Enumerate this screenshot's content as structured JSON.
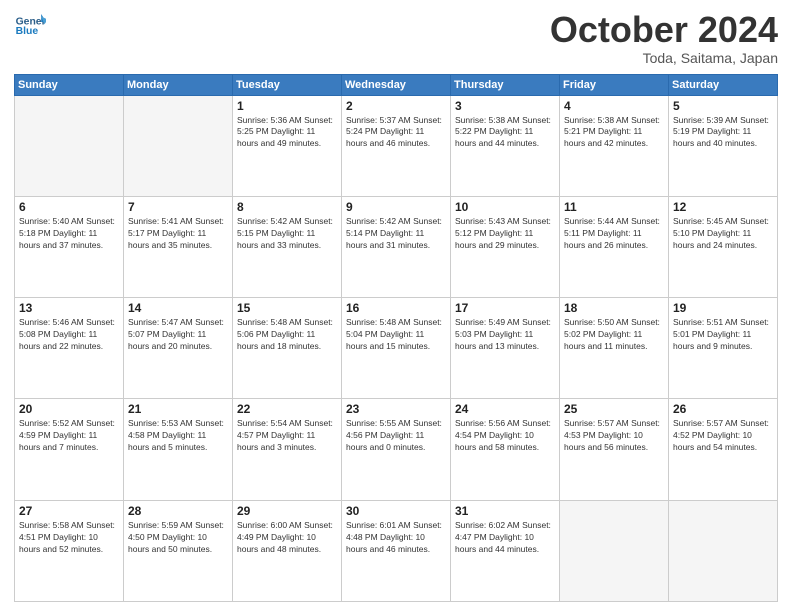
{
  "header": {
    "logo_line1": "General",
    "logo_line2": "Blue",
    "month_title": "October 2024",
    "location": "Toda, Saitama, Japan"
  },
  "weekdays": [
    "Sunday",
    "Monday",
    "Tuesday",
    "Wednesday",
    "Thursday",
    "Friday",
    "Saturday"
  ],
  "weeks": [
    [
      {
        "day": "",
        "info": ""
      },
      {
        "day": "",
        "info": ""
      },
      {
        "day": "1",
        "info": "Sunrise: 5:36 AM\nSunset: 5:25 PM\nDaylight: 11 hours and 49 minutes."
      },
      {
        "day": "2",
        "info": "Sunrise: 5:37 AM\nSunset: 5:24 PM\nDaylight: 11 hours and 46 minutes."
      },
      {
        "day": "3",
        "info": "Sunrise: 5:38 AM\nSunset: 5:22 PM\nDaylight: 11 hours and 44 minutes."
      },
      {
        "day": "4",
        "info": "Sunrise: 5:38 AM\nSunset: 5:21 PM\nDaylight: 11 hours and 42 minutes."
      },
      {
        "day": "5",
        "info": "Sunrise: 5:39 AM\nSunset: 5:19 PM\nDaylight: 11 hours and 40 minutes."
      }
    ],
    [
      {
        "day": "6",
        "info": "Sunrise: 5:40 AM\nSunset: 5:18 PM\nDaylight: 11 hours and 37 minutes."
      },
      {
        "day": "7",
        "info": "Sunrise: 5:41 AM\nSunset: 5:17 PM\nDaylight: 11 hours and 35 minutes."
      },
      {
        "day": "8",
        "info": "Sunrise: 5:42 AM\nSunset: 5:15 PM\nDaylight: 11 hours and 33 minutes."
      },
      {
        "day": "9",
        "info": "Sunrise: 5:42 AM\nSunset: 5:14 PM\nDaylight: 11 hours and 31 minutes."
      },
      {
        "day": "10",
        "info": "Sunrise: 5:43 AM\nSunset: 5:12 PM\nDaylight: 11 hours and 29 minutes."
      },
      {
        "day": "11",
        "info": "Sunrise: 5:44 AM\nSunset: 5:11 PM\nDaylight: 11 hours and 26 minutes."
      },
      {
        "day": "12",
        "info": "Sunrise: 5:45 AM\nSunset: 5:10 PM\nDaylight: 11 hours and 24 minutes."
      }
    ],
    [
      {
        "day": "13",
        "info": "Sunrise: 5:46 AM\nSunset: 5:08 PM\nDaylight: 11 hours and 22 minutes."
      },
      {
        "day": "14",
        "info": "Sunrise: 5:47 AM\nSunset: 5:07 PM\nDaylight: 11 hours and 20 minutes."
      },
      {
        "day": "15",
        "info": "Sunrise: 5:48 AM\nSunset: 5:06 PM\nDaylight: 11 hours and 18 minutes."
      },
      {
        "day": "16",
        "info": "Sunrise: 5:48 AM\nSunset: 5:04 PM\nDaylight: 11 hours and 15 minutes."
      },
      {
        "day": "17",
        "info": "Sunrise: 5:49 AM\nSunset: 5:03 PM\nDaylight: 11 hours and 13 minutes."
      },
      {
        "day": "18",
        "info": "Sunrise: 5:50 AM\nSunset: 5:02 PM\nDaylight: 11 hours and 11 minutes."
      },
      {
        "day": "19",
        "info": "Sunrise: 5:51 AM\nSunset: 5:01 PM\nDaylight: 11 hours and 9 minutes."
      }
    ],
    [
      {
        "day": "20",
        "info": "Sunrise: 5:52 AM\nSunset: 4:59 PM\nDaylight: 11 hours and 7 minutes."
      },
      {
        "day": "21",
        "info": "Sunrise: 5:53 AM\nSunset: 4:58 PM\nDaylight: 11 hours and 5 minutes."
      },
      {
        "day": "22",
        "info": "Sunrise: 5:54 AM\nSunset: 4:57 PM\nDaylight: 11 hours and 3 minutes."
      },
      {
        "day": "23",
        "info": "Sunrise: 5:55 AM\nSunset: 4:56 PM\nDaylight: 11 hours and 0 minutes."
      },
      {
        "day": "24",
        "info": "Sunrise: 5:56 AM\nSunset: 4:54 PM\nDaylight: 10 hours and 58 minutes."
      },
      {
        "day": "25",
        "info": "Sunrise: 5:57 AM\nSunset: 4:53 PM\nDaylight: 10 hours and 56 minutes."
      },
      {
        "day": "26",
        "info": "Sunrise: 5:57 AM\nSunset: 4:52 PM\nDaylight: 10 hours and 54 minutes."
      }
    ],
    [
      {
        "day": "27",
        "info": "Sunrise: 5:58 AM\nSunset: 4:51 PM\nDaylight: 10 hours and 52 minutes."
      },
      {
        "day": "28",
        "info": "Sunrise: 5:59 AM\nSunset: 4:50 PM\nDaylight: 10 hours and 50 minutes."
      },
      {
        "day": "29",
        "info": "Sunrise: 6:00 AM\nSunset: 4:49 PM\nDaylight: 10 hours and 48 minutes."
      },
      {
        "day": "30",
        "info": "Sunrise: 6:01 AM\nSunset: 4:48 PM\nDaylight: 10 hours and 46 minutes."
      },
      {
        "day": "31",
        "info": "Sunrise: 6:02 AM\nSunset: 4:47 PM\nDaylight: 10 hours and 44 minutes."
      },
      {
        "day": "",
        "info": ""
      },
      {
        "day": "",
        "info": ""
      }
    ]
  ]
}
